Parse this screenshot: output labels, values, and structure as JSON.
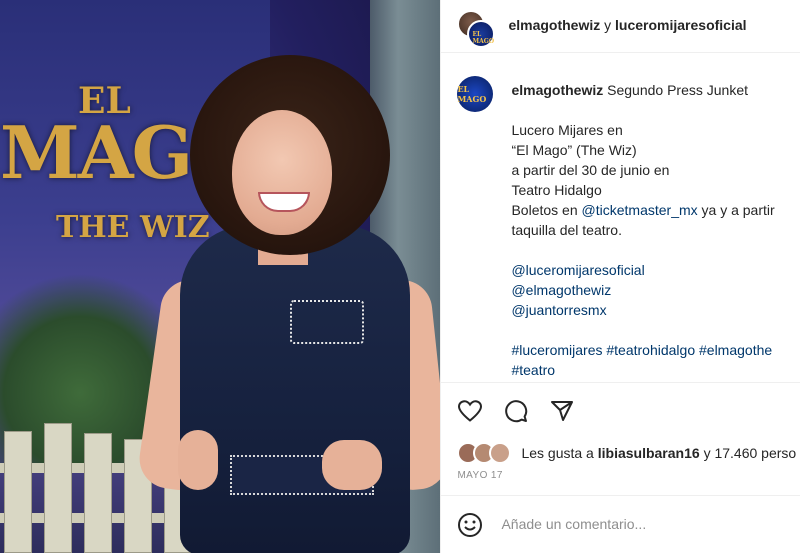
{
  "post": {
    "header": {
      "user1": "elmagothewiz",
      "joiner": "y",
      "user2": "luceromijaresoficial",
      "badge_text": "EL MAGO"
    },
    "caption": {
      "username": "elmagothewiz",
      "title": "Segundo Press Junket",
      "lines": [
        "Lucero Mijares en",
        "“El Mago” (The Wiz)",
        "a partir del 30 de junio en",
        "Teatro Hidalgo"
      ],
      "tickets_prefix": "Boletos en",
      "tickets_handle": "@ticketmaster_mx",
      "tickets_suffix": "ya y a partir",
      "tickets_line2": "taquilla del teatro.",
      "mentions": [
        "@luceromijaresoficial",
        "@elmagothewiz",
        "@juantorresmx"
      ],
      "hashtags_line1": "#luceromijares #teatrohidalgo #elmagothe",
      "hashtags_line2": "#teatro"
    },
    "likes": {
      "prefix": "Les gusta a",
      "user": "libiasulbaran16",
      "suffix": "y 17.460 perso"
    },
    "date": "MAYO 17",
    "add_comment_placeholder": "Añade un comentario..."
  },
  "photo": {
    "logo_el": "EL",
    "logo_mago": "MAGO",
    "logo_wiz": "THE WIZ"
  },
  "icons": {
    "like": "heart-icon",
    "comment": "comment-icon",
    "share": "send-icon",
    "emoji": "emoji-icon"
  },
  "colors": {
    "text": "#262626",
    "link": "#00376b",
    "muted": "#8e8e8e"
  }
}
